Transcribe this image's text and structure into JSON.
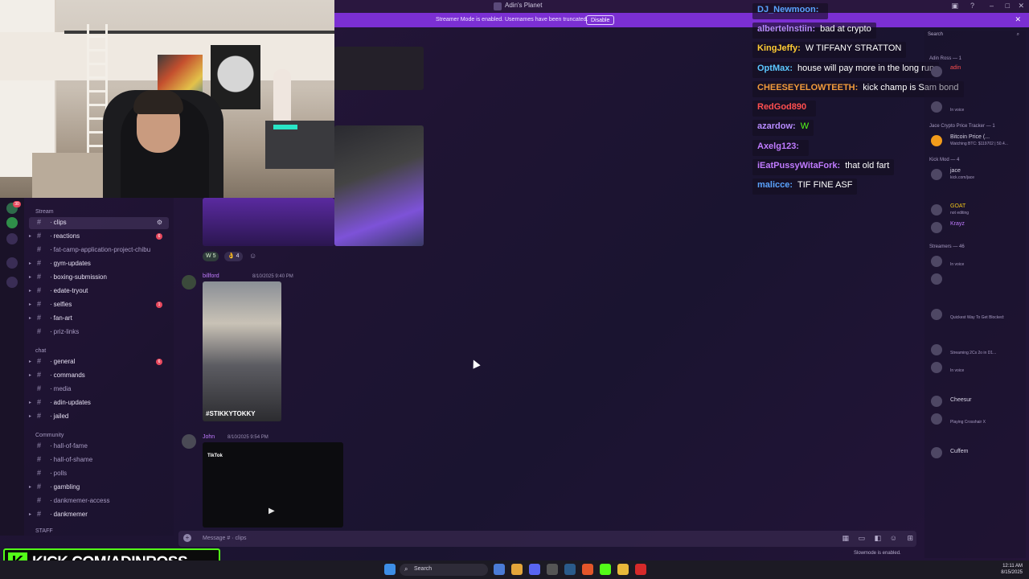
{
  "window": {
    "title": "Adin's Planet"
  },
  "banner": {
    "text": "Streamer Mode is enabled. Usernames have been truncated.",
    "disable_label": "Disable"
  },
  "channels": {
    "categories": [
      {
        "label": "Stream"
      },
      {
        "label": "chat"
      },
      {
        "label": "Community"
      },
      {
        "label": "STAFF"
      }
    ],
    "items": [
      {
        "name": "clips"
      },
      {
        "name": "reactions",
        "badge": "6"
      },
      {
        "name": "fat-camp-application-project-chibu"
      },
      {
        "name": "gym-updates"
      },
      {
        "name": "boxing-submission"
      },
      {
        "name": "edate-tryout"
      },
      {
        "name": "selfies",
        "badge": "1"
      },
      {
        "name": "fan-art"
      },
      {
        "name": "priz-links"
      },
      {
        "name": "general",
        "badge": "6"
      },
      {
        "name": "commands"
      },
      {
        "name": "media"
      },
      {
        "name": "adin-updates"
      },
      {
        "name": "jailed"
      },
      {
        "name": "hall-of-fame"
      },
      {
        "name": "hall-of-shame"
      },
      {
        "name": "polls"
      },
      {
        "name": "gambling"
      },
      {
        "name": "dankmemer-access"
      },
      {
        "name": "dankmemer"
      }
    ],
    "user_label": "adin"
  },
  "messages": [
    {
      "author": "billford",
      "meta": "8/10/2025 9:40 PM",
      "caption": "#STIKKYTOKKY"
    },
    {
      "author": "John",
      "meta": "8/10/2025 9:54 PM",
      "caption": "TikTok"
    }
  ],
  "reactions": [
    {
      "emoji": "W",
      "count": "5"
    },
    {
      "emoji": "👌",
      "count": "4"
    }
  ],
  "composer": {
    "placeholder": "Message # · clips",
    "slowmode": "Slowmode is enabled."
  },
  "overlay_chat": [
    {
      "user": "DJ_Newmoon:",
      "text": "",
      "color": "#5aa3ff"
    },
    {
      "user": "albertelnstiin:",
      "text": "bad at crypto",
      "color": "#b88cff"
    },
    {
      "user": "KingJeffy:",
      "text": "W TIFFANY STRATTON",
      "color": "#ffcc33"
    },
    {
      "user": "OptMax:",
      "text": "house will pay more in the long run",
      "color": "#5cc8ff"
    },
    {
      "user": "CHEESEYELOWTEETH:",
      "text": "kick champ is Sam bond",
      "color": "#f29b3b"
    },
    {
      "user": "RedGod890",
      "text": "",
      "color": "#ff4f4f"
    },
    {
      "user": "azardow:",
      "text": "W",
      "color": "#b88cff"
    },
    {
      "user": "Axelg123:",
      "text": "",
      "color": "#c07bff"
    },
    {
      "user": "iEatPussyWitaFork:",
      "text": "that old fart",
      "color": "#c07bff"
    },
    {
      "user": "malicce:",
      "text": "TIF FINE ASF",
      "color": "#5aa3ff"
    }
  ],
  "members": {
    "search_placeholder": "Search",
    "groups": [
      {
        "label": "Adin Ross — 1"
      },
      {
        "label": "Jace Crypto Price Tracker — 1"
      },
      {
        "label": "Kick Mod — 4"
      },
      {
        "label": "Streamers — 46"
      }
    ],
    "rows": [
      {
        "name": "adin",
        "status": "",
        "color": "#ff4f4f"
      },
      {
        "name": "",
        "status": "In voice",
        "color": "#d8d4e6"
      },
      {
        "name": "Bitcoin Price (...",
        "status": "Watching BTC: $119702 | 50.4...",
        "color": "#d8d4e6"
      },
      {
        "name": "jace",
        "status": "kick.com/jace",
        "color": "#d8d4e6"
      },
      {
        "name": "GOAT",
        "status": "not editing",
        "color": "#f0c419"
      },
      {
        "name": "Krayz",
        "status": "",
        "color": "#c07bff"
      },
      {
        "name": "",
        "status": "In voice",
        "color": "#c07bff"
      },
      {
        "name": "",
        "status": "",
        "color": "#c07bff"
      },
      {
        "name": "",
        "status": "Quickest Way To Get Blocked:",
        "color": "#c07bff"
      },
      {
        "name": "",
        "status": "Streaming 2Cs 2o in D1...",
        "color": "#c07bff"
      },
      {
        "name": "",
        "status": "In voice",
        "color": "#c07bff"
      },
      {
        "name": "Cheesur",
        "status": "",
        "color": "#d8d4e6"
      },
      {
        "name": "",
        "status": "Playing Crosshair X",
        "color": "#c07bff"
      },
      {
        "name": "Cuffem",
        "status": "",
        "color": "#d8d4e6"
      }
    ]
  },
  "kick": {
    "url": "KICK.COM/ADINROSS"
  },
  "taskbar": {
    "search": "Search",
    "time": "12:11 AM",
    "date": "8/15/2025"
  }
}
